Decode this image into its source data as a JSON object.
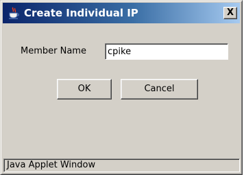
{
  "window": {
    "title": "Create Individual IP",
    "icon": "java-coffee-cup-icon",
    "close_glyph": "X",
    "titlebar_colors": [
      "#0a246a",
      "#a6caf0"
    ]
  },
  "form": {
    "member_name_label": "Member Name",
    "member_name_value": "cpike"
  },
  "buttons": {
    "ok_label": "OK",
    "cancel_label": "Cancel"
  },
  "status_bar": {
    "text": "Java Applet Window"
  }
}
